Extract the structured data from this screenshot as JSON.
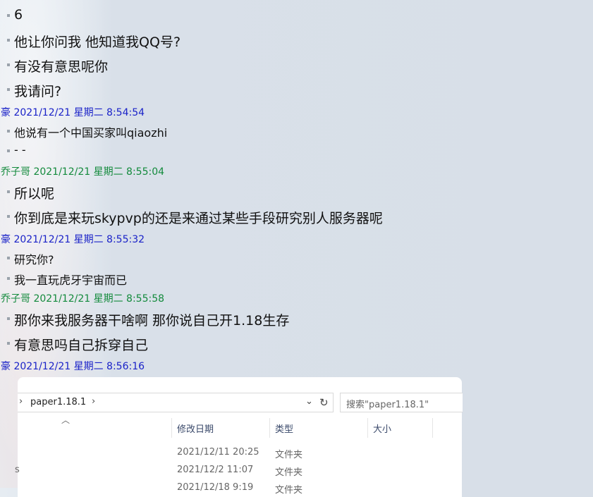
{
  "chat": {
    "m1": "6",
    "m2": "他让你问我 他知道我QQ号?",
    "m3": "有没有意思呢你",
    "m4": "我请问?",
    "h1": "豪 2021/12/21 星期二 8:54:54",
    "m5": "他说有一个中国买家叫qiaozhi",
    "m6": "- -",
    "h2": "乔子哥 2021/12/21 星期二 8:55:04",
    "m7": "所以呢",
    "m8": "你到底是来玩skypvp的还是来通过某些手段研究别人服务器呢",
    "h3": "豪 2021/12/21 星期二 8:55:32",
    "m9": "研究你?",
    "m10": "我一直玩虎牙宇宙而已",
    "h4": "乔子哥 2021/12/21 星期二 8:55:58",
    "m11": "那你来我服务器干啥啊 那你说自己开1.18生存",
    "m12": "有意思吗自己拆穿自己",
    "h5": "豪 2021/12/21 星期二 8:56:16"
  },
  "colors": {
    "blue_header": "#1a22c8",
    "green_header": "#138a3c"
  },
  "explorer": {
    "path": "paper1.18.1",
    "search_placeholder": "搜索\"paper1.18.1\"",
    "col_date": "修改日期",
    "col_type": "类型",
    "col_size": "大小",
    "rows": [
      {
        "date": "2021/12/11 20:25",
        "type": "文件夹"
      },
      {
        "date": "2021/12/2 11:07",
        "type": "文件夹"
      },
      {
        "date": "2021/12/18 9:19",
        "type": "文件夹"
      }
    ],
    "left_clip": "s"
  }
}
